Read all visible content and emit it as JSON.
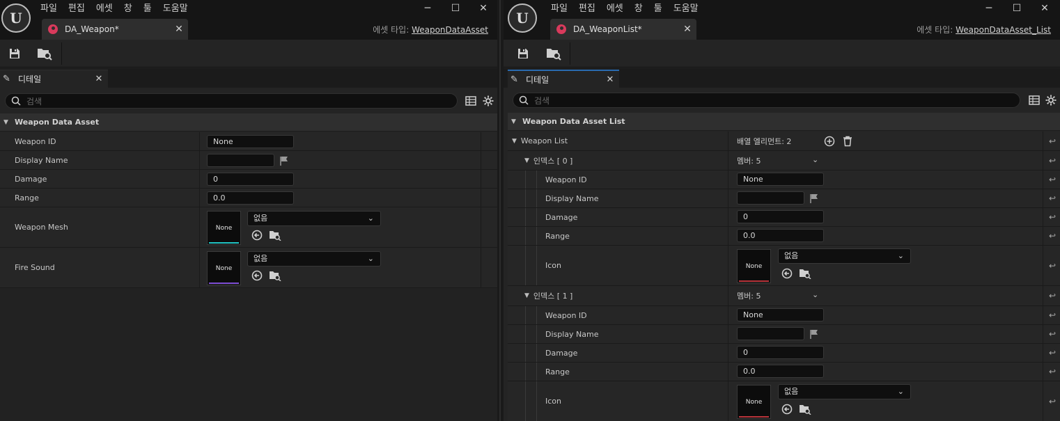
{
  "menu": [
    "파일",
    "편집",
    "에셋",
    "창",
    "툴",
    "도움말"
  ],
  "window_controls": [
    "─",
    "☐",
    "✕"
  ],
  "colors": {
    "accent_blue": "#2a6bb0",
    "asset_icon": "#d93a5c",
    "mesh_bar": "#21c4c4",
    "sound_bar": "#7f4fd6",
    "icon_bar": "#b8343b"
  },
  "left": {
    "tab_title": "DA_Weapon*",
    "asset_type_prefix": "에셋 타입:",
    "asset_type": "WeaponDataAsset",
    "panel_tab": "디테일",
    "search_placeholder": "검색",
    "category": "Weapon Data Asset",
    "rows": {
      "weapon_id": {
        "label": "Weapon ID",
        "value": "None"
      },
      "display_name": {
        "label": "Display Name",
        "value": ""
      },
      "damage": {
        "label": "Damage",
        "value": "0"
      },
      "range": {
        "label": "Range",
        "value": "0.0"
      },
      "weapon_mesh": {
        "label": "Weapon Mesh",
        "thumb": "None",
        "combo": "없음"
      },
      "fire_sound": {
        "label": "Fire Sound",
        "thumb": "None",
        "combo": "없음"
      }
    }
  },
  "right": {
    "tab_title": "DA_WeaponList*",
    "asset_type_prefix": "에셋 타입:",
    "asset_type": "WeaponDataAsset_List",
    "panel_tab": "디테일",
    "search_placeholder": "검색",
    "category": "Weapon Data Asset List",
    "weapon_list": {
      "label": "Weapon List",
      "count": "배열 엘리먼트: 2"
    },
    "elements": [
      {
        "index": "인덱스 [ 0 ]",
        "members": "멤버: 5",
        "weapon_id": {
          "label": "Weapon ID",
          "value": "None"
        },
        "display_name": {
          "label": "Display Name",
          "value": ""
        },
        "damage": {
          "label": "Damage",
          "value": "0"
        },
        "range": {
          "label": "Range",
          "value": "0.0"
        },
        "icon": {
          "label": "Icon",
          "thumb": "None",
          "combo": "없음"
        }
      },
      {
        "index": "인덱스 [ 1 ]",
        "members": "멤버: 5",
        "weapon_id": {
          "label": "Weapon ID",
          "value": "None"
        },
        "display_name": {
          "label": "Display Name",
          "value": ""
        },
        "damage": {
          "label": "Damage",
          "value": "0"
        },
        "range": {
          "label": "Range",
          "value": "0.0"
        },
        "icon": {
          "label": "Icon",
          "thumb": "None",
          "combo": "없음"
        }
      }
    ]
  }
}
